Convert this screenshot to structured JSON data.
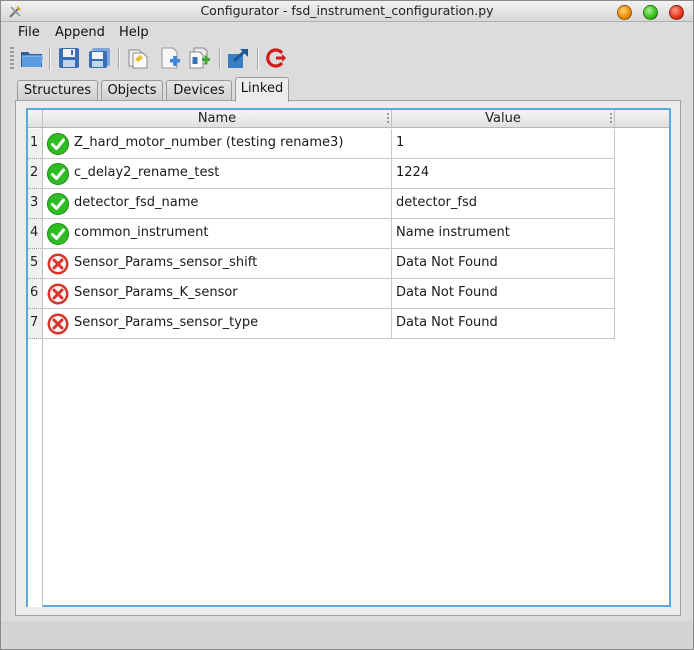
{
  "window": {
    "title": "Configurator - fsd_instrument_configuration.py"
  },
  "menu": {
    "file": "File",
    "append": "Append",
    "help": "Help"
  },
  "toolbar": {
    "icons": [
      "open-folder-icon",
      "save-icon",
      "save-as-icon",
      "copy-icon",
      "add-document-icon",
      "duplicate-icon",
      "export-icon",
      "refresh-icon"
    ]
  },
  "tabs": [
    {
      "label": "Structures",
      "active": false
    },
    {
      "label": "Objects",
      "active": false
    },
    {
      "label": "Devices",
      "active": false
    },
    {
      "label": "Linked",
      "active": true
    }
  ],
  "table": {
    "columns": {
      "name": "Name",
      "value": "Value"
    },
    "rows": [
      {
        "num": "1",
        "status": "ok",
        "name": "Z_hard_motor_number (testing rename3)",
        "value": "1"
      },
      {
        "num": "2",
        "status": "ok",
        "name": "c_delay2_rename_test",
        "value": "1224"
      },
      {
        "num": "3",
        "status": "ok",
        "name": "detector_fsd_name",
        "value": "detector_fsd"
      },
      {
        "num": "4",
        "status": "ok",
        "name": "common_instrument",
        "value": "Name instrument"
      },
      {
        "num": "5",
        "status": "error",
        "name": "Sensor_Params_sensor_shift",
        "value": "Data Not Found"
      },
      {
        "num": "6",
        "status": "error",
        "name": "Sensor_Params_K_sensor",
        "value": "Data Not Found"
      },
      {
        "num": "7",
        "status": "error",
        "name": "Sensor_Params_sensor_type",
        "value": "Data Not Found"
      }
    ]
  },
  "colors": {
    "ok": "#2ebd22",
    "error": "#d9342b",
    "focus": "#5aa8e0"
  }
}
